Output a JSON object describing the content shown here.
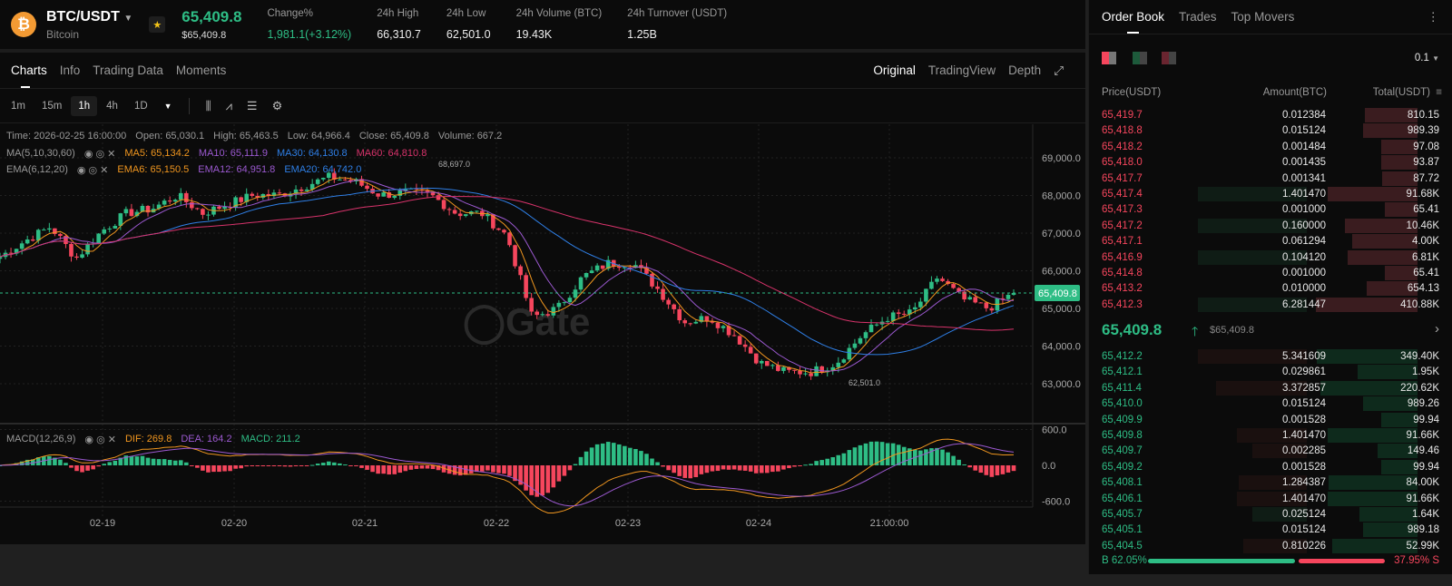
{
  "header": {
    "coin_icon": "bitcoin-icon",
    "symbol": "BTC/USDT",
    "name": "Bitcoin",
    "price": "65,409.8",
    "price_usd": "$65,409.8",
    "stats": [
      {
        "label": "Change%",
        "value": "1,981.1(+3.12%)",
        "color": "#2ebd85"
      },
      {
        "label": "24h High",
        "value": "66,310.7"
      },
      {
        "label": "24h Low",
        "value": "62,501.0"
      },
      {
        "label": "24h Volume (BTC)",
        "value": "19.43K"
      },
      {
        "label": "24h Turnover (USDT)",
        "value": "1.25B"
      }
    ]
  },
  "tabs": [
    "Charts",
    "Info",
    "Trading Data",
    "Moments"
  ],
  "view_tabs": [
    "Original",
    "TradingView",
    "Depth"
  ],
  "intervals": [
    "1m",
    "15m",
    "1h",
    "4h",
    "1D"
  ],
  "active_interval": "1h",
  "legend": {
    "ohlc": [
      "Time: 2026-02-25 16:00:00",
      "Open: 65,030.1",
      "High: 65,463.5",
      "Low: 64,966.4",
      "Close: 65,409.8",
      "Volume: 667.2"
    ],
    "ma": {
      "label": "MA(5,10,30,60)",
      "items": [
        {
          "t": "MA5: 65,134.2",
          "c": "#f0961f"
        },
        {
          "t": "MA10: 65,111.9",
          "c": "#9b59d0"
        },
        {
          "t": "MA30: 64,130.8",
          "c": "#2f7fe6"
        },
        {
          "t": "MA60: 64,810.8",
          "c": "#d8336b"
        }
      ]
    },
    "ema": {
      "label": "EMA(6,12,20)",
      "items": [
        {
          "t": "EMA6: 65,150.5",
          "c": "#f0961f"
        },
        {
          "t": "EMA12: 64,951.8",
          "c": "#9b59d0"
        },
        {
          "t": "EMA20: 64,742.0",
          "c": "#2f7fe6"
        }
      ]
    },
    "macd": {
      "label": "MACD(12,26,9)",
      "items": [
        {
          "t": "DIF: 269.8",
          "c": "#f0961f"
        },
        {
          "t": "DEA: 164.2",
          "c": "#9b59d0"
        },
        {
          "t": "MACD: 211.2",
          "c": "#2ebd85"
        }
      ]
    }
  },
  "watermark": "Gate",
  "chart_data": {
    "type": "candlestick",
    "interval": "1h",
    "y_ticks": [
      "69,000.0",
      "68,000.0",
      "67,000.0",
      "66,000.0",
      "65,000.0",
      "64,000.0",
      "63,000.0"
    ],
    "ylim": [
      62500,
      69500
    ],
    "macd_ticks": [
      "600.0",
      "0.0",
      "-600.0"
    ],
    "x_ticks": [
      "02-19",
      "02-20",
      "02-21",
      "02-22",
      "02-23",
      "02-24",
      "21:00:00"
    ],
    "high_label": "68,697.0",
    "low_label": "62,501.0",
    "last_price": "65,409.8",
    "approx_close_path": [
      66370,
      66800,
      67170,
      66330,
      67050,
      67530,
      67650,
      68000,
      67530,
      67770,
      68010,
      68010,
      68250,
      68490,
      68370,
      68010,
      68080,
      68010,
      67530,
      67530,
      66930,
      64760,
      65000,
      65840,
      66200,
      66200,
      65480,
      64640,
      64760,
      64280,
      63550,
      63310,
      63310,
      63550,
      64280,
      64760,
      64880,
      65840,
      65240,
      65000,
      65410
    ],
    "colors": {
      "up": "#2ebd85",
      "down": "#f6465d"
    }
  },
  "orderbook": {
    "tabs": [
      "Order Book",
      "Trades",
      "Top Movers"
    ],
    "precision": "0.1",
    "cols": [
      "Price(USDT)",
      "Amount(BTC)",
      "Total(USDT)"
    ],
    "asks": [
      [
        "65,419.7",
        "0.012384",
        "810.15"
      ],
      [
        "65,418.8",
        "0.015124",
        "989.39"
      ],
      [
        "65,418.2",
        "0.001484",
        "97.08"
      ],
      [
        "65,418.0",
        "0.001435",
        "93.87"
      ],
      [
        "65,417.7",
        "0.001341",
        "87.72"
      ],
      [
        "65,417.4",
        "1.401470",
        "91.68K"
      ],
      [
        "65,417.3",
        "0.001000",
        "65.41"
      ],
      [
        "65,417.2",
        "0.160000",
        "10.46K"
      ],
      [
        "65,417.1",
        "0.061294",
        "4.00K"
      ],
      [
        "65,416.9",
        "0.104120",
        "6.81K"
      ],
      [
        "65,414.8",
        "0.001000",
        "65.41"
      ],
      [
        "65,413.2",
        "0.010000",
        "654.13"
      ],
      [
        "65,412.3",
        "6.281447",
        "410.88K"
      ]
    ],
    "mid_price": "65,409.8",
    "mid_usd": "$65,409.8",
    "bids": [
      [
        "65,412.2",
        "5.341609",
        "349.40K"
      ],
      [
        "65,412.1",
        "0.029861",
        "1.95K"
      ],
      [
        "65,411.4",
        "3.372857",
        "220.62K"
      ],
      [
        "65,410.0",
        "0.015124",
        "989.26"
      ],
      [
        "65,409.9",
        "0.001528",
        "99.94"
      ],
      [
        "65,409.8",
        "1.401470",
        "91.66K"
      ],
      [
        "65,409.7",
        "0.002285",
        "149.46"
      ],
      [
        "65,409.2",
        "0.001528",
        "99.94"
      ],
      [
        "65,408.1",
        "1.284387",
        "84.00K"
      ],
      [
        "65,406.1",
        "1.401470",
        "91.66K"
      ],
      [
        "65,405.7",
        "0.025124",
        "1.64K"
      ],
      [
        "65,405.1",
        "0.015124",
        "989.18"
      ],
      [
        "65,404.5",
        "0.810226",
        "52.99K"
      ]
    ],
    "buy_pct": "B 62.05%",
    "sell_pct": "37.95% S",
    "buy_ratio": 0.6205
  }
}
